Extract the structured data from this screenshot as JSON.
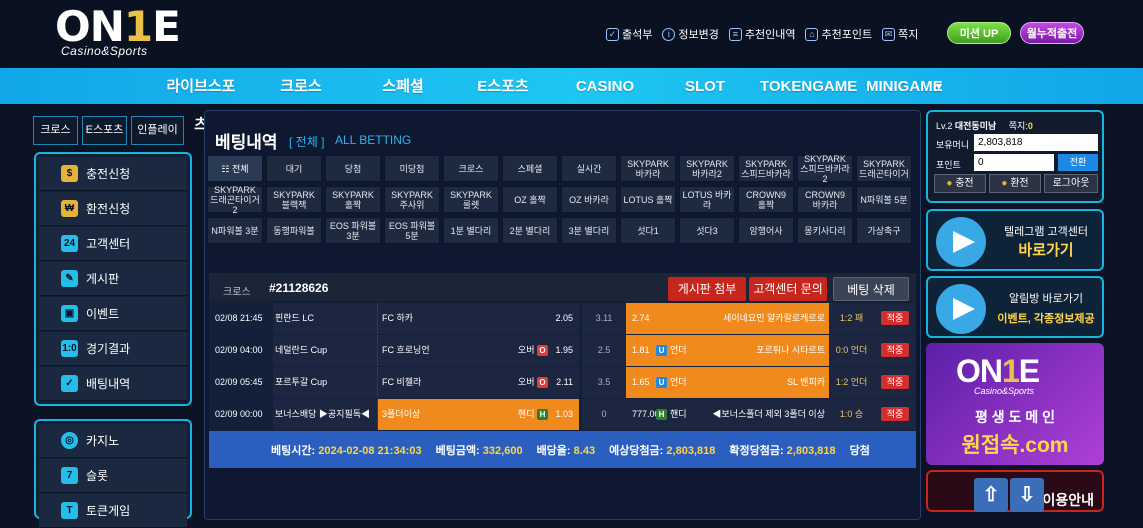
{
  "logo": {
    "main_a": "ON",
    "main_b": "1",
    "main_c": "E",
    "sub": "Casino&Sports"
  },
  "toplinks": [
    {
      "label": "출석부",
      "icon": "check-icon"
    },
    {
      "label": "정보변경",
      "icon": "info-icon"
    },
    {
      "label": "추천인내역",
      "icon": "list-icon"
    },
    {
      "label": "추천포인트",
      "icon": "home-icon"
    },
    {
      "label": "쪽지",
      "icon": "mail-icon"
    }
  ],
  "mission": "미션 UP",
  "attend": "월누적출전",
  "nav": [
    "라이브스포츠",
    "크로스",
    "스페셜",
    "E스포츠",
    "CASINO",
    "SLOT",
    "TOKENGAME",
    "MINIGAME"
  ],
  "left_tabs": [
    "크로스",
    "E스포츠",
    "인플레이"
  ],
  "menu1": [
    {
      "label": "충전신청",
      "icon": "money-bag-icon"
    },
    {
      "label": "환전신청",
      "icon": "coins-icon"
    },
    {
      "label": "고객센터",
      "icon": "support-icon"
    },
    {
      "label": "게시판",
      "icon": "board-icon"
    },
    {
      "label": "이벤트",
      "icon": "gift-icon"
    },
    {
      "label": "경기결과",
      "icon": "scoreboard-icon"
    },
    {
      "label": "배팅내역",
      "icon": "bet-history-icon"
    }
  ],
  "menu2": [
    {
      "label": "카지노",
      "icon": "casino-chip-icon"
    },
    {
      "label": "슬롯",
      "icon": "slot-icon"
    },
    {
      "label": "토큰게임",
      "icon": "token-icon"
    }
  ],
  "betting": {
    "title": "베팅내역",
    "sub1": "[ 전체 ]",
    "sub2": "ALL BETTING"
  },
  "tabs": [
    "☷ 전체",
    "대기",
    "당첨",
    "미당첨",
    "크로스",
    "스페셜",
    "실시간",
    "SKYPARK 바카라",
    "SKYPARK 바카라2",
    "SKYPARK 스피드바카라",
    "SKYPARK 스피드바카라2",
    "SKYPARK 드래곤타이거",
    "SKYPARK 드래곤타이거2",
    "SKYPARK 블랙잭",
    "SKYPARK 홀짝",
    "SKYPARK 주사위",
    "SKYPARK 룰렛",
    "OZ 홀짝",
    "OZ 바카라",
    "LOTUS 홀짝",
    "LOTUS 바카라",
    "CROWN9 홀짝",
    "CROWN9 바카라",
    "N파워볼 5분",
    "N파워볼 3분",
    "동행파워볼",
    "EOS 파워볼 3분",
    "EOS 파워볼 5분",
    "1분 별다리",
    "2분 별다리",
    "3분 별다리",
    "섯다1",
    "섯다3",
    "암행어사",
    "몽키사다리",
    "가상축구"
  ],
  "bet": {
    "type": "크로스",
    "id": "#21128626",
    "btn_board": "게시판 첨부",
    "btn_support": "고객센터 문의",
    "btn_delete": "베팅 삭제",
    "rows": [
      {
        "dt": "02/08 21:45",
        "league": "핀란드 LC",
        "home": "FC 하카",
        "home_ou": "",
        "home_badge": "",
        "home_odds": "2.05",
        "mid": "3.11",
        "away_odds": "2.74",
        "away_lbl": "",
        "away_badge": "",
        "away": "세이네요민 얄카랄로케르로",
        "score": "1:2 패",
        "status": "적중",
        "pick": "away"
      },
      {
        "dt": "02/09 04:00",
        "league": "네덜란드 Cup",
        "home": "FC 흐로닝언",
        "home_ou": "오버",
        "home_badge": "O",
        "home_odds": "1.95",
        "mid": "2.5",
        "away_odds": "1.81",
        "away_lbl": "언더",
        "away_badge": "U",
        "away": "포르튀나 시타르트",
        "score": "0:0 언더",
        "status": "적중",
        "pick": "away"
      },
      {
        "dt": "02/09 05:45",
        "league": "포르투갈 Cup",
        "home": "FC 비젤라",
        "home_ou": "오버",
        "home_badge": "O",
        "home_odds": "2.11",
        "mid": "3.5",
        "away_odds": "1.65",
        "away_lbl": "언더",
        "away_badge": "U",
        "away": "SL 벤피카",
        "score": "1:2 언더",
        "status": "적중",
        "pick": "away"
      },
      {
        "dt": "02/09 00:00",
        "league": "보너스배당 ▶공지필독◀",
        "home": "3폴더이상",
        "home_ou": "핸디",
        "home_badge": "H",
        "home_odds": "1.03",
        "mid": "0",
        "away_odds": "777.00",
        "away_lbl": "핸디",
        "away_badge": "H",
        "away": "◀보너스폴더 제외 3폴더 이상",
        "score": "1:0 승",
        "status": "적중",
        "pick": "home"
      }
    ],
    "summary": {
      "time_l": "베팅시간:",
      "time_v": "2024-02-08 21:34:03",
      "amt_l": "베팅금액:",
      "amt_v": "332,600",
      "rate_l": "배당율:",
      "rate_v": "8.43",
      "exp_l": "예상당첨금:",
      "exp_v": "2,803,818",
      "conf_l": "확정당첨금:",
      "conf_v": "2,803,818",
      "result": "당첨"
    }
  },
  "user": {
    "level": "Lv.2",
    "name": "대전동미남",
    "msg_l": "쪽지:",
    "msg_v": "0",
    "money_l": "보유머니",
    "money_v": "2,803,818",
    "point_l": "포인트",
    "point_v": "0",
    "convert": "전환",
    "charge": "충전",
    "exchange": "환전",
    "logout": "로그아웃"
  },
  "telegram1": {
    "t1": "텔레그램 고객센터",
    "t2": "바로가기"
  },
  "telegram2": {
    "t1": "알림방 바로가기",
    "t2": "이벤트, 각종정보제공"
  },
  "ad": {
    "sub": "Casino&Sports",
    "t1": "평 생 도 메 인",
    "t2": "원접속.com"
  },
  "ad2": "이용안내",
  "colors": {
    "accent": "#19b3e0",
    "nav": "#1ec6f2",
    "pick": "#f08a1c",
    "status": "#d32f2f"
  }
}
